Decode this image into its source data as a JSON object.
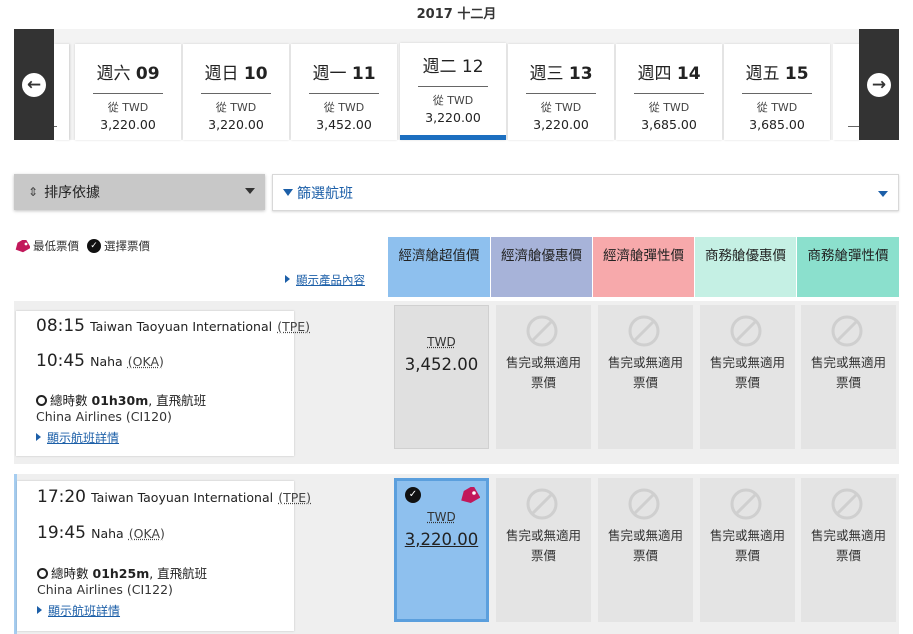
{
  "month_label": "2017 十二月",
  "dates": [
    {
      "day": "週六",
      "num": "09",
      "from": "從 TWD",
      "price": "3,220.00"
    },
    {
      "day": "週日",
      "num": "10",
      "from": "從 TWD",
      "price": "3,220.00"
    },
    {
      "day": "週一",
      "num": "11",
      "from": "從 TWD",
      "price": "3,452.00"
    },
    {
      "day": "週二",
      "num": "12",
      "from": "從 TWD",
      "price": "3,220.00",
      "selected": true
    },
    {
      "day": "週三",
      "num": "13",
      "from": "從 TWD",
      "price": "3,220.00"
    },
    {
      "day": "週四",
      "num": "14",
      "from": "從 TWD",
      "price": "3,685.00"
    },
    {
      "day": "週五",
      "num": "15",
      "from": "從 TWD",
      "price": "3,685.00"
    }
  ],
  "sort": {
    "label": "排序依據"
  },
  "filter": {
    "label": "篩選航班"
  },
  "legend": {
    "lowest": "最低票價",
    "selected": "選擇票價"
  },
  "show_products": "顯示產品內容",
  "fare_columns": [
    {
      "label": "經濟艙超值價",
      "color": "#8ec0ee"
    },
    {
      "label": "經濟艙優惠價",
      "color": "#a7b3d9"
    },
    {
      "label": "經濟艙彈性價",
      "color": "#f7a9ab"
    },
    {
      "label": "商務艙優惠價",
      "color": "#c5f0e4"
    },
    {
      "label": "商務艙彈性價",
      "color": "#8be0cd"
    }
  ],
  "flights": [
    {
      "dep_time": "08:15",
      "dep_city": "Taiwan Taoyuan International",
      "dep_code": "(TPE)",
      "arr_time": "10:45",
      "arr_city": "Naha",
      "arr_code": "(OKA)",
      "duration_label": "總時數",
      "duration": "01h30m",
      "stops": ", 直飛航班",
      "airline": "China Airlines (CI120)",
      "detail_link": "顯示航班詳情",
      "fare": {
        "currency": "TWD",
        "amount": "3,452.00"
      },
      "unavailable": "售完或無適用\n票價"
    },
    {
      "dep_time": "17:20",
      "dep_city": "Taiwan Taoyuan International",
      "dep_code": "(TPE)",
      "arr_time": "19:45",
      "arr_city": "Naha",
      "arr_code": "(OKA)",
      "duration_label": "總時數",
      "duration": "01h25m",
      "stops": ", 直飛航班",
      "airline": "China Airlines (CI122)",
      "detail_link": "顯示航班詳情",
      "fare": {
        "currency": "TWD",
        "amount": "3,220.00"
      },
      "unavailable": "售完或無適用\n票價"
    }
  ],
  "icons": {
    "prev": "arrow-left-circle-icon",
    "next": "arrow-right-circle-icon",
    "lowest": "price-tag-icon",
    "selected": "check-circle-icon",
    "unavailable": "prohibited-icon",
    "duration": "stopwatch-icon"
  }
}
